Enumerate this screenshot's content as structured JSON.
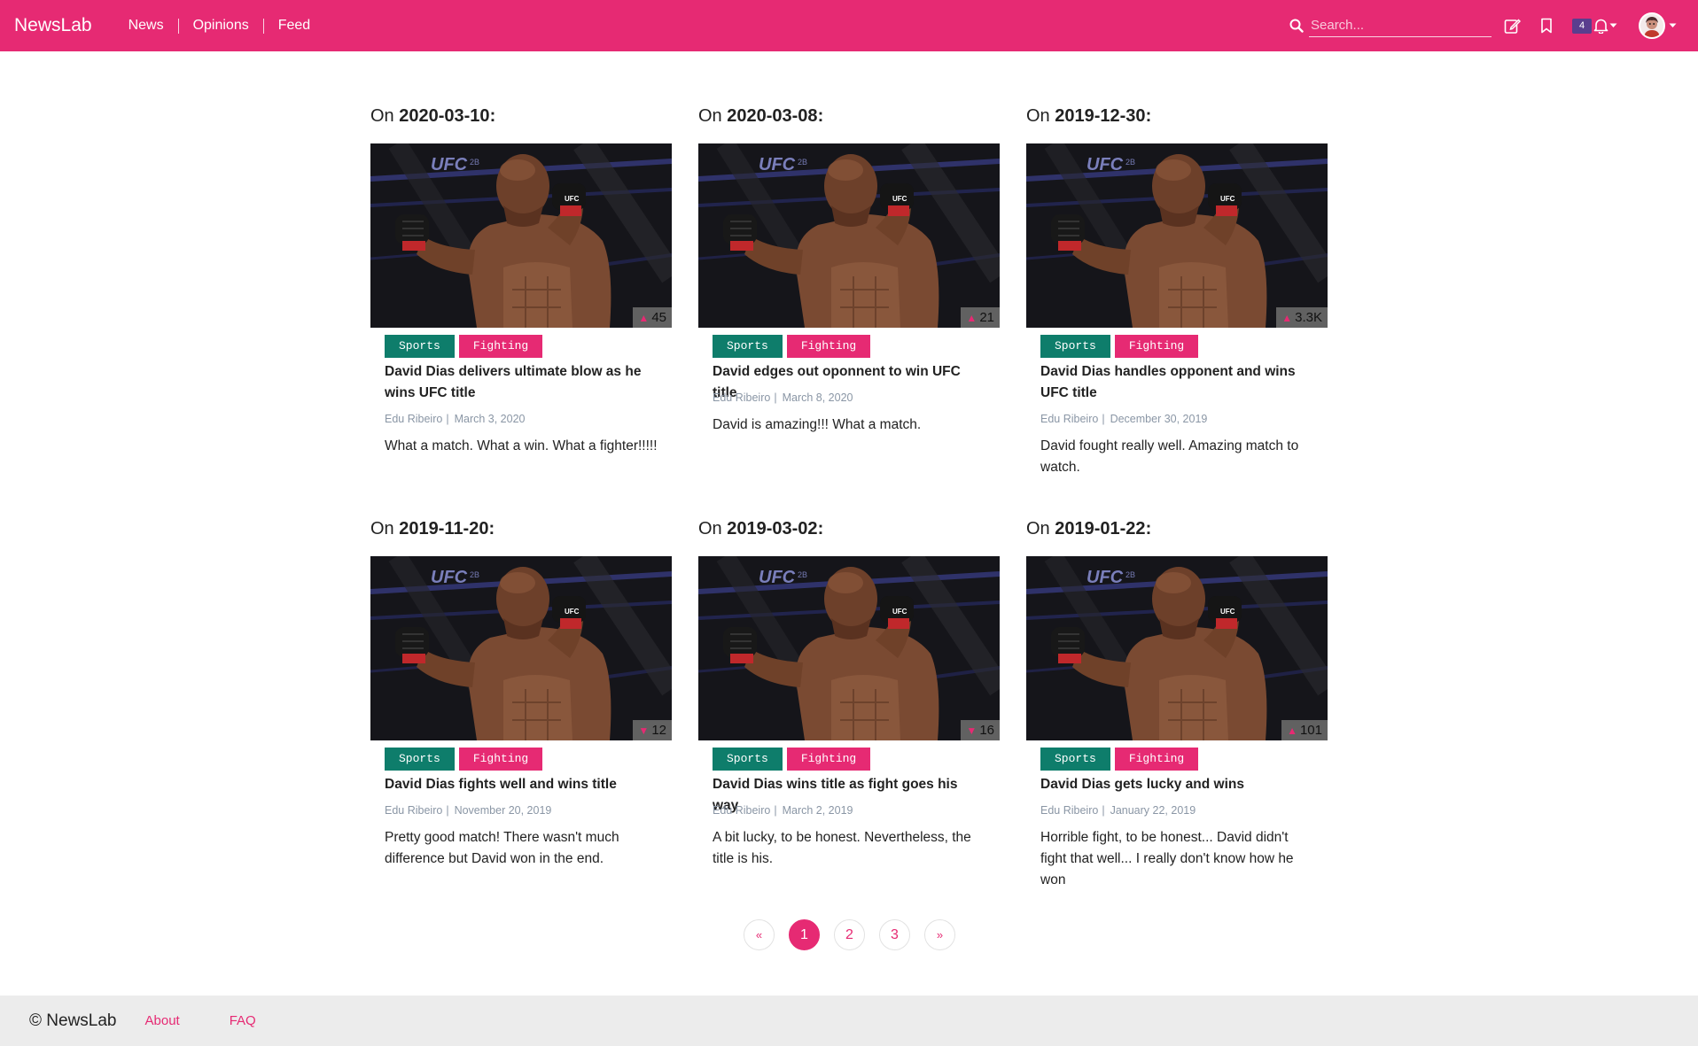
{
  "navbar": {
    "brand": "NewsLab",
    "links": [
      "News",
      "Opinions",
      "Feed"
    ],
    "search_placeholder": "Search...",
    "notification_count": "4"
  },
  "articles": [
    {
      "date_prefix": "On ",
      "date": "2020-03-10",
      "date_suffix": ":",
      "votes": "45",
      "vote_direction": "up",
      "tags": [
        "Sports",
        "Fighting"
      ],
      "title": "David Dias delivers ultimate blow as he wins UFC title",
      "author": "Edu Ribeiro",
      "published": "March 3, 2020",
      "excerpt": "What a match. What a win. What a fighter!!!!!"
    },
    {
      "date_prefix": "On ",
      "date": "2020-03-08",
      "date_suffix": ":",
      "votes": "21",
      "vote_direction": "up",
      "tags": [
        "Sports",
        "Fighting"
      ],
      "title": "David edges out oponnent to win UFC title",
      "author": "Edu Ribeiro",
      "published": "March 8, 2020",
      "excerpt": "David is amazing!!! What a match."
    },
    {
      "date_prefix": "On ",
      "date": "2019-12-30",
      "date_suffix": ":",
      "votes": "3.3K",
      "vote_direction": "up",
      "tags": [
        "Sports",
        "Fighting"
      ],
      "title": "David Dias handles opponent and wins UFC title",
      "author": "Edu Ribeiro",
      "published": "December 30, 2019",
      "excerpt": "David fought really well. Amazing match to watch."
    },
    {
      "date_prefix": "On ",
      "date": "2019-11-20",
      "date_suffix": ":",
      "votes": "12",
      "vote_direction": "down",
      "tags": [
        "Sports",
        "Fighting"
      ],
      "title": "David Dias fights well and wins title",
      "author": "Edu Ribeiro",
      "published": "November 20, 2019",
      "excerpt": "Pretty good match! There wasn't much difference but David won in the end."
    },
    {
      "date_prefix": "On ",
      "date": "2019-03-02",
      "date_suffix": ":",
      "votes": "16",
      "vote_direction": "down",
      "tags": [
        "Sports",
        "Fighting"
      ],
      "title": "David Dias wins title as fight goes his way",
      "author": "Edu Ribeiro",
      "published": "March 2, 2019",
      "excerpt": "A bit lucky, to be honest. Nevertheless, the title is his."
    },
    {
      "date_prefix": "On ",
      "date": "2019-01-22",
      "date_suffix": ":",
      "votes": "101",
      "vote_direction": "up",
      "tags": [
        "Sports",
        "Fighting"
      ],
      "title": "David Dias gets lucky and wins",
      "author": "Edu Ribeiro",
      "published": "January 22, 2019",
      "excerpt": "Horrible fight, to be honest... David didn't fight that well... I really don't know how he won"
    }
  ],
  "pagination": {
    "prev": "«",
    "pages": [
      "1",
      "2",
      "3"
    ],
    "current": "1",
    "next": "»"
  },
  "footer": {
    "copyright": "© NewsLab",
    "links": [
      "About",
      "FAQ"
    ]
  },
  "colors": {
    "brand": "#e62a73",
    "tag_sports": "#0e7d6b",
    "tag_fighting": "#e62a73",
    "badge": "#5a3e8e"
  }
}
